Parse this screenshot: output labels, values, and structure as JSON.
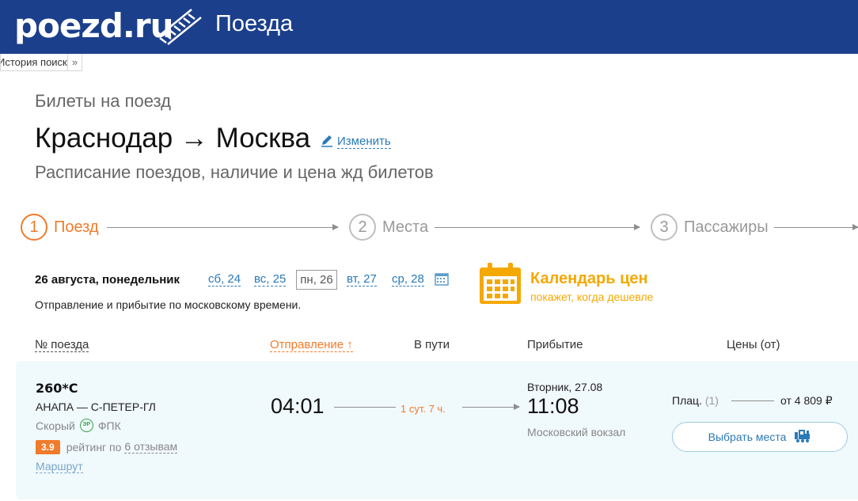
{
  "header": {
    "logo": "poezd.ru",
    "section": "Поезда"
  },
  "history": {
    "tab_label": "История поиска",
    "arrow": "»"
  },
  "page": {
    "subtitle_top": "Билеты на поезд",
    "route_title": "Краснодар → Москва",
    "change_label": "Изменить",
    "subtitle_bottom": "Расписание поездов, наличие и цена жд билетов"
  },
  "steps": [
    {
      "num": "1",
      "label": "Поезд"
    },
    {
      "num": "2",
      "label": "Места"
    },
    {
      "num": "3",
      "label": "Пассажиры"
    }
  ],
  "dates": {
    "current": "26 августа, понедельник",
    "days": [
      "сб, 24",
      "вс, 25",
      "пн, 26",
      "вт, 27",
      "ср, 28"
    ],
    "note": "Отправление и прибытие по московскому времени."
  },
  "price_calendar": {
    "title": "Календарь цен",
    "subtitle": "покажет, когда дешевле"
  },
  "table_headers": {
    "train_num": "№ поезда",
    "departure": "Отправление ↑",
    "duration": "В пути",
    "arrival": "Прибытие",
    "prices": "Цены (от)"
  },
  "train": {
    "number": "260*С",
    "route": "АНАПА — С-ПЕТЕР-ГЛ",
    "type": "Скорый",
    "er_badge": "ЭР",
    "carrier": "ФПК",
    "rating": "3.9",
    "rating_text": "рейтинг по",
    "reviews": "6 отзывам",
    "route_link": "Маршрут",
    "departure_time": "04:01",
    "duration": "1 сут. 7 ч.",
    "arrival_date": "Вторник, 27.08",
    "arrival_time": "11:08",
    "arrival_station": "Московский вокзал",
    "price_class": "Плац.",
    "price_count": "(1)",
    "price": "от 4 809 ₽",
    "select_label": "Выбрать места"
  }
}
